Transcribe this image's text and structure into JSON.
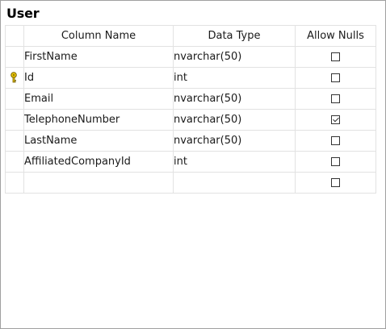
{
  "window": {
    "title": "User"
  },
  "grid": {
    "headers": {
      "column_name": "Column Name",
      "data_type": "Data Type",
      "allow_nulls": "Allow Nulls"
    },
    "rows": [
      {
        "name": "FirstName",
        "type": "nvarchar(50)",
        "allow_nulls": false,
        "primary_key": false
      },
      {
        "name": "Id",
        "type": "int",
        "allow_nulls": false,
        "primary_key": true
      },
      {
        "name": "Email",
        "type": "nvarchar(50)",
        "allow_nulls": false,
        "primary_key": false
      },
      {
        "name": "TelephoneNumber",
        "type": "nvarchar(50)",
        "allow_nulls": true,
        "primary_key": false
      },
      {
        "name": "LastName",
        "type": "nvarchar(50)",
        "allow_nulls": false,
        "primary_key": false
      },
      {
        "name": "AffiliatedCompanyId",
        "type": "int",
        "allow_nulls": false,
        "primary_key": false
      },
      {
        "name": "",
        "type": "",
        "allow_nulls": false,
        "primary_key": false
      }
    ],
    "icons": {
      "primary_key": "key-icon"
    },
    "colors": {
      "key": "#d4b000",
      "grid_line": "#e2e2e2",
      "border": "#a0a0a0"
    }
  }
}
